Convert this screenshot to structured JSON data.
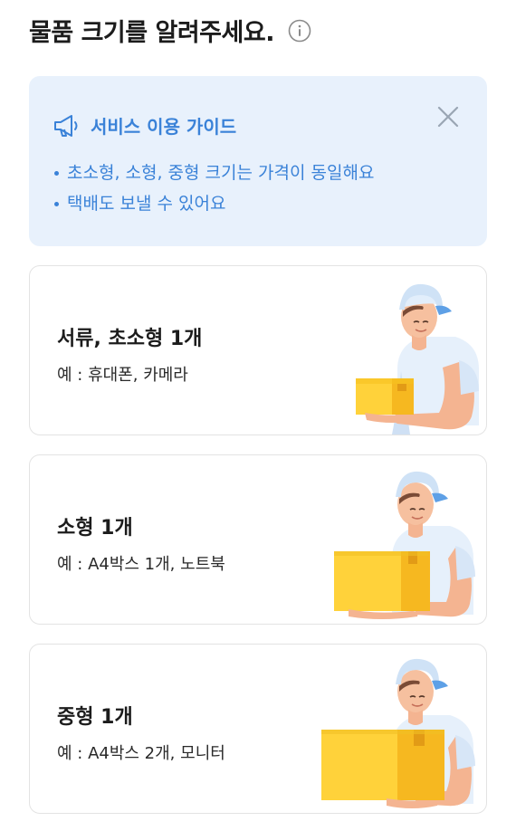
{
  "header": {
    "title": "물품 크기를 알려주세요.",
    "info_icon": "info-circle-icon"
  },
  "guide": {
    "icon": "megaphone-icon",
    "title": "서비스 이용 가이드",
    "close_icon": "close-icon",
    "items": [
      "초소형, 소형, 중형 크기는 가격이 동일해요",
      "택배도 보낼 수 있어요"
    ],
    "accent_color": "#3a82d8",
    "background": "#e8f1fc"
  },
  "options": [
    {
      "title": "서류, 초소형 1개",
      "example": "예 : 휴대폰, 카메라",
      "illustration": "courier-small-box"
    },
    {
      "title": "소형 1개",
      "example": "예 : A4박스 1개, 노트북",
      "illustration": "courier-medium-box"
    },
    {
      "title": "중형 1개",
      "example": "예 : A4박스 2개, 모니터",
      "illustration": "courier-large-box"
    }
  ]
}
